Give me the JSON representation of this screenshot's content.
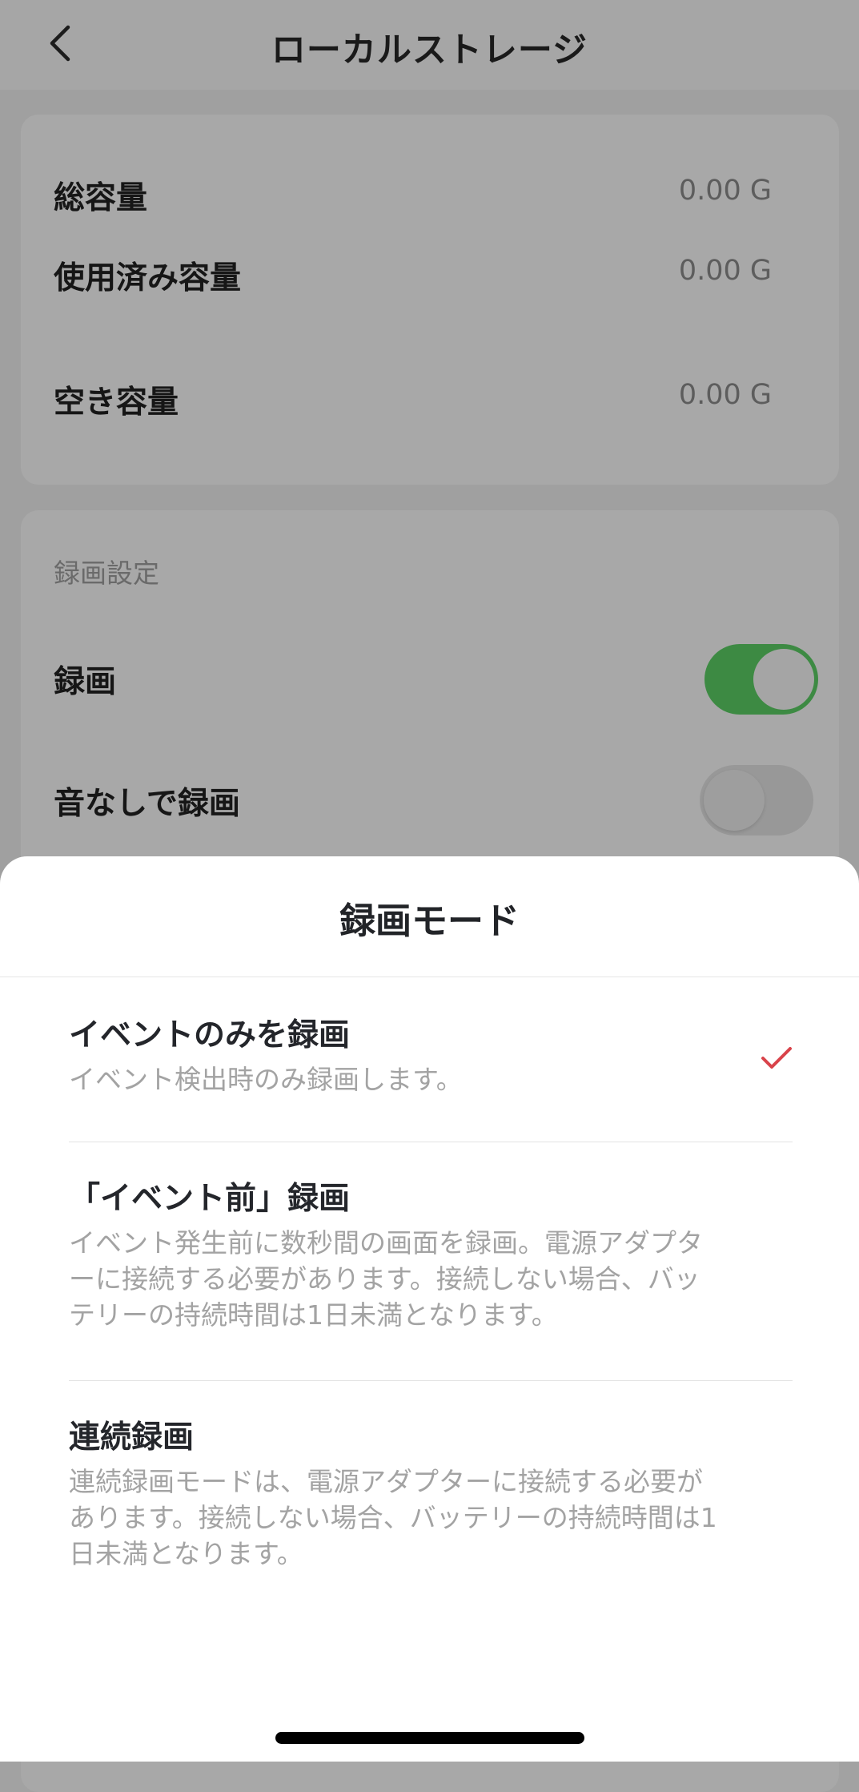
{
  "navbar": {
    "title": "ローカルストレージ",
    "back_icon": "chevron-left-icon"
  },
  "storage": {
    "rows": [
      {
        "label": "総容量",
        "value": "0.00 G"
      },
      {
        "label": "使用済み容量",
        "value": "0.00 G"
      },
      {
        "label": "空き容量",
        "value": "0.00 G"
      }
    ]
  },
  "recording": {
    "section_title": "録画設定",
    "rows": [
      {
        "label": "録画",
        "toggle": "on"
      },
      {
        "label": "音なしで録画",
        "toggle": "off"
      }
    ],
    "toggle_on_color": "#3d8a43"
  },
  "sheet": {
    "title": "録画モード",
    "options": [
      {
        "title": "イベントのみを録画",
        "desc_lines": [
          "イベント検出時のみ録画します。"
        ],
        "selected": true
      },
      {
        "title": "「イベント前」録画",
        "desc_lines": [
          "イベント発生前に数秒間の画面を録画。電源アダプタ",
          "ーに接続する必要があります。接続しない場合、バッ",
          "テリーの持続時間は1日未満となります。"
        ],
        "selected": false
      },
      {
        "title": "連続録画",
        "desc_lines": [
          "連続録画モードは、電源アダプターに接続する必要が",
          "あります。接続しない場合、バッテリーの持続時間は1",
          "日未満となります。"
        ],
        "selected": false
      }
    ],
    "check_color": "#d9434a",
    "check_icon": "checkmark-icon"
  }
}
